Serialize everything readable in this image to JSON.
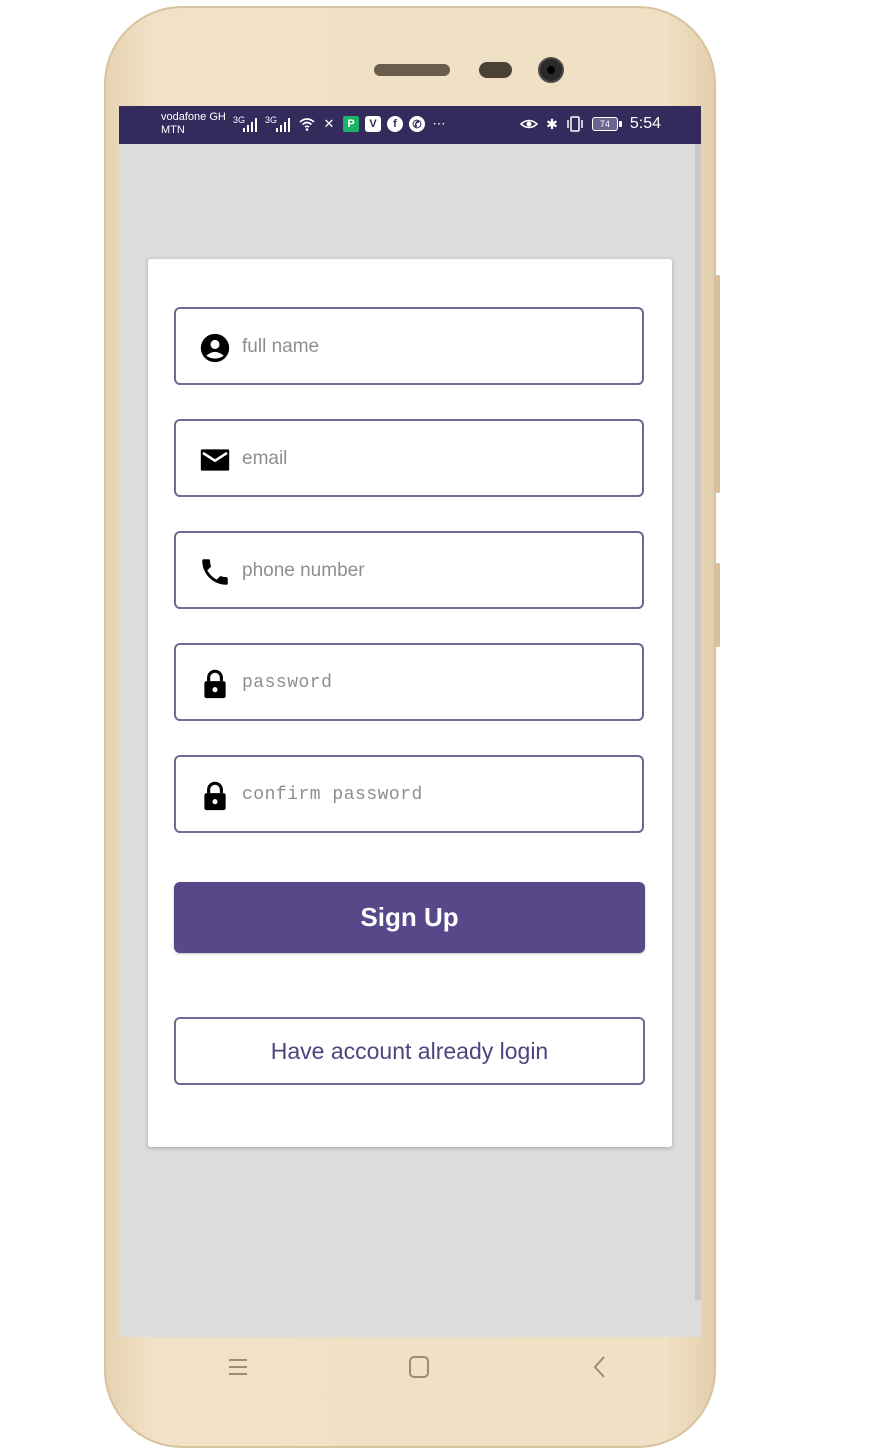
{
  "statusbar": {
    "carrier_primary": "vodafone GH",
    "carrier_secondary": "MTN",
    "signal1_label": "3G",
    "signal2_label": "3G",
    "app_icons": [
      "wifi-icon",
      "satellite-icon",
      "p-app-icon",
      "v-app-icon",
      "facebook-icon",
      "whatsapp-icon",
      "more-icon"
    ],
    "battery_level": "74",
    "time": "5:54"
  },
  "form": {
    "full_name_placeholder": "full name",
    "email_placeholder": "email",
    "phone_placeholder": "phone number",
    "password_placeholder": "password",
    "confirm_password_placeholder": "confirm password",
    "signup_label": "Sign Up",
    "login_label": "Have account already login"
  },
  "colors": {
    "accent": "#57488a",
    "statusbar": "#342a5c",
    "field_border": "#6f6994",
    "screen_bg": "#dcdcdc"
  }
}
